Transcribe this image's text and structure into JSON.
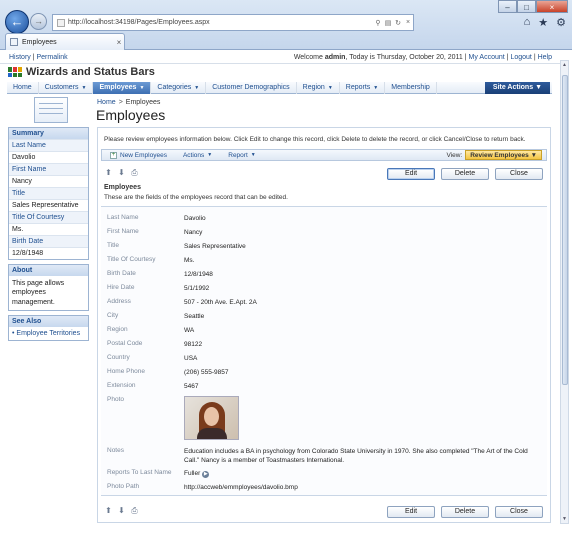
{
  "browser": {
    "url": "http://localhost:34198/Pages/Employees.aspx",
    "tab_title": "Employees"
  },
  "toplinks": {
    "history": "History",
    "permalink": "Permalink",
    "welcome_prefix": "Welcome",
    "user": "admin",
    "today": ", Today is Thursday, October 20, 2011",
    "my_account": "My Account",
    "logout": "Logout",
    "help": "Help"
  },
  "brand": {
    "title": "Wizards and Status Bars"
  },
  "menu": {
    "items": [
      "Home",
      "Customers",
      "Employees",
      "Categories",
      "Customer Demographics",
      "Region",
      "Reports",
      "Membership"
    ],
    "site_actions": "Site Actions"
  },
  "sidebar": {
    "summary_title": "Summary",
    "summary": [
      {
        "label": "Last Name",
        "value": "Davolio"
      },
      {
        "label": "First Name",
        "value": "Nancy"
      },
      {
        "label": "Title",
        "value": "Sales Representative"
      },
      {
        "label": "Title Of Courtesy",
        "value": "Ms."
      },
      {
        "label": "Birth Date",
        "value": "12/8/1948"
      }
    ],
    "about_title": "About",
    "about_text": "This page allows employees management.",
    "see_also_title": "See Also",
    "see_also_link": "Employee Territories"
  },
  "breadcrumb": {
    "home": "Home",
    "sep": ">",
    "current": "Employees"
  },
  "page_title": "Employees",
  "instruction": "Please review employees information below. Click Edit to change this record, click Delete to delete the record, or click Cancel/Close to return back.",
  "actionbar": {
    "new": "New Employees",
    "actions": "Actions",
    "report": "Report",
    "view_label": "View:",
    "view_value": "Review Employees"
  },
  "buttons": {
    "edit": "Edit",
    "delete": "Delete",
    "close": "Close"
  },
  "form": {
    "heading": "Employees",
    "subheading": "These are the fields of the employees record that can be edited.",
    "fields": [
      {
        "label": "Last Name",
        "value": "Davolio"
      },
      {
        "label": "First Name",
        "value": "Nancy"
      },
      {
        "label": "Title",
        "value": "Sales Representative"
      },
      {
        "label": "Title Of Courtesy",
        "value": "Ms."
      },
      {
        "label": "Birth Date",
        "value": "12/8/1948"
      },
      {
        "label": "Hire Date",
        "value": "5/1/1992"
      },
      {
        "label": "Address",
        "value": "507 - 20th Ave. E.Apt. 2A"
      },
      {
        "label": "City",
        "value": "Seattle"
      },
      {
        "label": "Region",
        "value": "WA"
      },
      {
        "label": "Postal Code",
        "value": "98122"
      },
      {
        "label": "Country",
        "value": "USA"
      },
      {
        "label": "Home Phone",
        "value": "(206) 555-9857"
      },
      {
        "label": "Extension",
        "value": "5467"
      },
      {
        "label": "Photo",
        "value": ""
      },
      {
        "label": "Notes",
        "value": "Education includes a BA in psychology from Colorado State University in 1970. She also completed \"The Art of the Cold Call.\" Nancy is a member of Toastmasters International."
      },
      {
        "label": "Reports To Last Name",
        "value": "Fuller"
      },
      {
        "label": "Photo Path",
        "value": "http://accweb/emmployees/davolio.bmp"
      }
    ]
  },
  "colors": {
    "accent": "#1f4f8f",
    "menu_active": "#3d6fb2",
    "view_select": "#f4c542"
  }
}
